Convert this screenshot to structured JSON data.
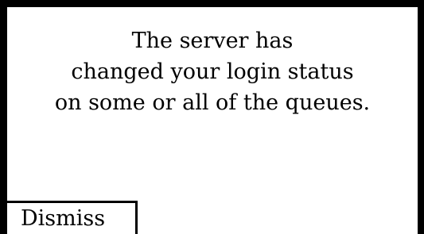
{
  "dialog": {
    "message_lines": [
      "The server has",
      "changed your login status",
      "on some or all of the queues."
    ],
    "dismiss_label": "Dismiss"
  }
}
